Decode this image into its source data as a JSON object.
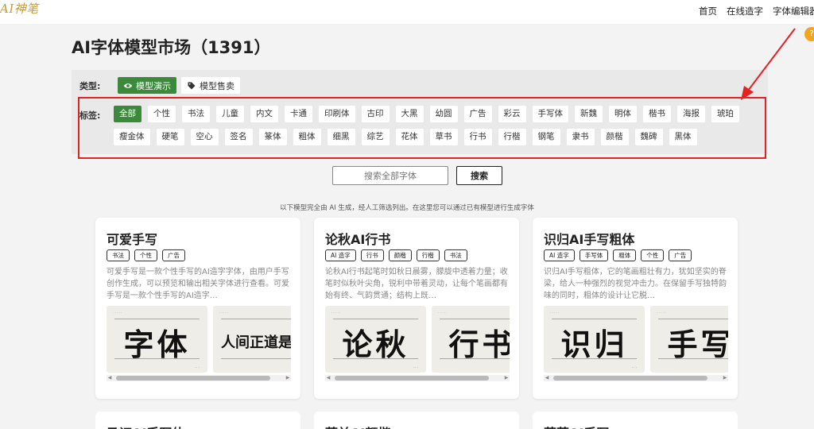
{
  "header": {
    "logo": "AI神笔",
    "nav": [
      "首页",
      "在线造字",
      "字体编辑器"
    ]
  },
  "page_title": "AI字体模型市场（1391）",
  "filters": {
    "type_label": "类型:",
    "types": [
      {
        "label": "模型演示",
        "active": true,
        "icon": "eye-icon"
      },
      {
        "label": "模型售卖",
        "active": false,
        "icon": "tag-icon"
      }
    ],
    "tag_label": "标签:",
    "tags": [
      "全部",
      "个性",
      "书法",
      "儿童",
      "内文",
      "卡通",
      "印刷体",
      "古印",
      "大黑",
      "幼圆",
      "广告",
      "彩云",
      "手写体",
      "新魏",
      "明体",
      "楷书",
      "海报",
      "琥珀",
      "瘦金体",
      "硬笔",
      "空心",
      "签名",
      "篆体",
      "粗体",
      "细黑",
      "综艺",
      "花体",
      "草书",
      "行书",
      "行楷",
      "钢笔",
      "隶书",
      "颜楷",
      "魏碑",
      "黑体"
    ],
    "active_tag": "全部"
  },
  "search": {
    "placeholder": "搜索全部字体",
    "button": "搜索"
  },
  "notice": "以下模型完全由 AI 生成，经人工筛选列出。在这里您可以通过已有模型进行生成字体",
  "cards": [
    {
      "title": "可爱手写",
      "tags": [
        "书法",
        "个性",
        "广告"
      ],
      "desc": "可爱手写是一款个性手写的AI造字字体，由用户手写创作生成，可以预览和输出相关字体进行查看。可爱手写是一款个性手写的AI造字…",
      "previews": [
        "字体",
        "人间正道是沧"
      ]
    },
    {
      "title": "论秋AI行书",
      "tags": [
        "AI 造字",
        "行书",
        "颜楷",
        "行楷",
        "书法"
      ],
      "desc": "论秋AI行书起笔时如秋日晨雾，朦胧中透着力量；收笔时似秋叶尖角，锐利中带着灵动，让每个笔画都有始有终、气韵贯通；结构上既…",
      "previews": [
        "论秋",
        "行书"
      ]
    },
    {
      "title": "识归AI手写粗体",
      "tags": [
        "AI 造字",
        "手写体",
        "粗体",
        "个性",
        "广告"
      ],
      "desc": "识归AI手写粗体，它的笔画粗壮有力，犹如坚实的脊梁，给人一种强烈的视觉冲击力。在保留手写独特韵味的同时，粗体的设计让它脱…",
      "previews": [
        "识归",
        "手写"
      ]
    }
  ],
  "cards_bottom": [
    {
      "title": "马证AI手写体"
    },
    {
      "title": "蒂兰AI颜楷"
    },
    {
      "title": "草草AI手写"
    }
  ],
  "colors": {
    "accent_green": "#3b8a3b",
    "annotation_red": "#e52222",
    "logo_gold": "#c69a3a"
  }
}
